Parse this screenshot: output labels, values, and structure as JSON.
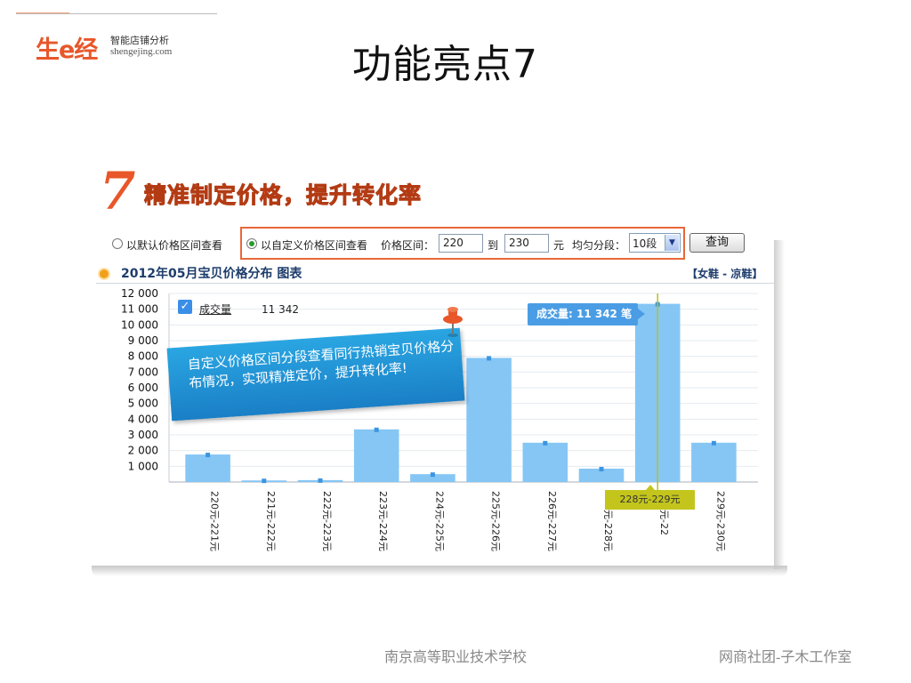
{
  "header": {
    "logo_mark": "生e经",
    "logo_tagline": "智能店铺分析",
    "logo_domain": "shengejing.com",
    "slide_title": "功能亮点7"
  },
  "feature": {
    "number": "7",
    "headline": "精准制定价格，提升转化率"
  },
  "filters": {
    "default_radio_label": "以默认价格区间查看",
    "custom_radio_label": "以自定义价格区间查看",
    "selected_mode": "custom",
    "price_range_label": "价格区间：",
    "price_from": "220",
    "to_label": "到",
    "price_to": "230",
    "unit_label": "元",
    "segment_label": "均匀分段：",
    "segment_value": "10段",
    "query_button": "查询"
  },
  "chart_header": {
    "title": "2012年05月宝贝价格分布  图表",
    "category": "【女鞋 - 凉鞋】"
  },
  "legend": {
    "checked": true,
    "label": "成交量",
    "value": "11 342"
  },
  "callout": {
    "text": "自定义价格区间分段查看同行热销宝贝价格分布情况，实现精准定价，提升转化率!"
  },
  "tooltip": {
    "text": "成交量: 11 342 笔",
    "range_tag": "228元-229元"
  },
  "colors": {
    "accent": "#e8562a",
    "bar": "#85c6f5",
    "bar_top": "#3c95e0",
    "callout": "#1f8fd4",
    "tooltip": "#4a9de4",
    "highlight_tag": "#c3c51c"
  },
  "chart_data": {
    "type": "bar",
    "categories": [
      "220元-221元",
      "221元-222元",
      "222元-223元",
      "223元-224元",
      "224元-225元",
      "225元-226元",
      "226元-227元",
      "227元-228元",
      "228元-22",
      "229元-230元"
    ],
    "series": [
      {
        "name": "成交量",
        "values": [
          1750,
          100,
          120,
          3350,
          500,
          7900,
          2500,
          850,
          11342,
          2500
        ]
      }
    ],
    "yticks": [
      "1 000",
      "2 000",
      "3 000",
      "4 000",
      "5 000",
      "6 000",
      "7 000",
      "8 000",
      "9 000",
      "10 000",
      "11 000",
      "12 000"
    ],
    "ylim": [
      0,
      12000
    ],
    "grid": true,
    "highlight_index": 8
  },
  "footer": {
    "school": "南京高等职业技术学校",
    "studio": "网商社团-子木工作室"
  }
}
